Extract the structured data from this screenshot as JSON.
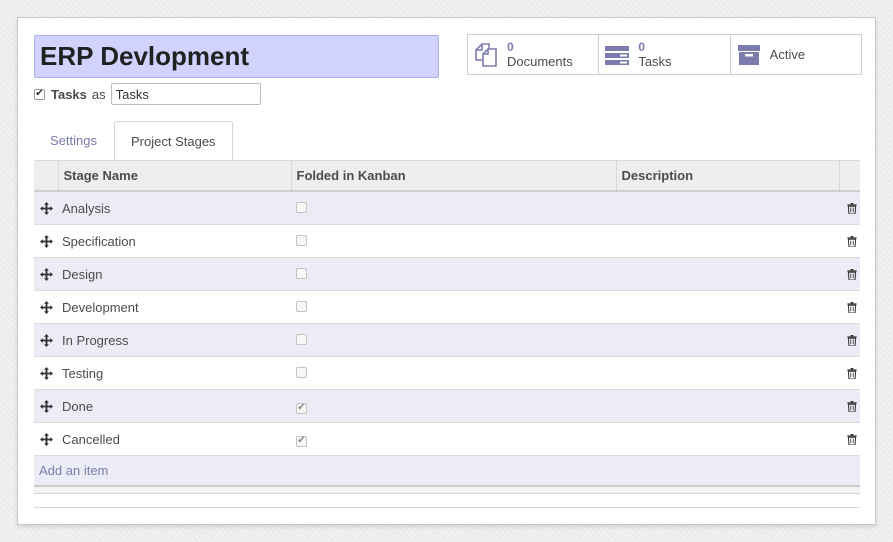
{
  "project": {
    "name": "ERP Devlopment",
    "tasks_label": "Tasks",
    "as_word": "as",
    "tasks_alias": "Tasks"
  },
  "smart_buttons": [
    {
      "count": "0",
      "label": "Documents",
      "icon": "documents-icon"
    },
    {
      "count": "0",
      "label": "Tasks",
      "icon": "tasks-icon"
    },
    {
      "label": "Active",
      "icon": "archive-icon"
    }
  ],
  "tabs": [
    {
      "label": "Settings",
      "active": false
    },
    {
      "label": "Project Stages",
      "active": true
    }
  ],
  "stages_table": {
    "columns": [
      "Stage Name",
      "Folded in Kanban",
      "Description"
    ],
    "rows": [
      {
        "name": "Analysis",
        "folded": false,
        "description": ""
      },
      {
        "name": "Specification",
        "folded": false,
        "description": ""
      },
      {
        "name": "Design",
        "folded": false,
        "description": ""
      },
      {
        "name": "Development",
        "folded": false,
        "description": ""
      },
      {
        "name": "In Progress",
        "folded": false,
        "description": ""
      },
      {
        "name": "Testing",
        "folded": false,
        "description": ""
      },
      {
        "name": "Done",
        "folded": true,
        "description": ""
      },
      {
        "name": "Cancelled",
        "folded": true,
        "description": ""
      }
    ],
    "add_item_label": "Add an item"
  },
  "colors": {
    "title_bg": "#d2d2ff",
    "accent": "#7c7bad",
    "active_status": "#2f7a3c",
    "odd_row": "#ebecf5"
  }
}
